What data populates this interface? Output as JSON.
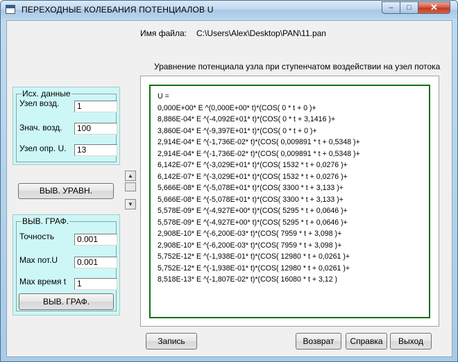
{
  "window": {
    "title": "ПЕРЕХОДНЫЕ КОЛЕБАНИЯ ПОТЕНЦИАЛОВ  U",
    "controls": {
      "minimize": "‒",
      "maximize": "□",
      "close": "✕"
    }
  },
  "file": {
    "label": "Имя файла:",
    "path": "C:\\Users\\Alex\\Desktop\\PAN\\11.pan"
  },
  "equation_caption": "Уравнение  потенциала  узла  при ступенчатом воздействии на узел   потока",
  "input_data": {
    "title": "Исх. данные",
    "fields": [
      {
        "label": "Узел  возд.",
        "value": "1"
      },
      {
        "label": "Знач. возд.",
        "value": "100"
      },
      {
        "label": "Узел опр. U.",
        "value": "13"
      }
    ]
  },
  "show_equation_button": "ВЫВ. УРАВН.",
  "graph": {
    "title": "ВЫВ. ГРАФ.",
    "fields": [
      {
        "label": "Точность",
        "value": "0.001"
      },
      {
        "label": "Max пот.U",
        "value": "0.001"
      },
      {
        "label": "Max время t",
        "value": "1"
      }
    ],
    "button": "ВЫВ. ГРАФ."
  },
  "scroll": {
    "up_arrow": "▲",
    "down_arrow": "▼"
  },
  "equation_lines": [
    "U =",
    "0,000E+00* E ^(0,000E+00* t)*(COS( 0 * t + 0 )+",
    "8,886E-04* E ^(-4,092E+01* t)*(COS( 0 * t + 3,1416 )+",
    "3,860E-04* E ^(-9,397E+01* t)*(COS( 0 * t + 0 )+",
    "2,914E-04* E ^(-1,736E-02* t)*(COS( 0,009891 * t + 0,5348 )+",
    "2,914E-04* E ^(-1,736E-02* t)*(COS( 0,009891 * t + 0,5348 )+",
    "6,142E-07* E ^(-3,029E+01* t)*(COS( 1532 * t + 0,0276 )+",
    "6,142E-07* E ^(-3,029E+01* t)*(COS( 1532 * t + 0,0276 )+",
    "5,666E-08* E ^(-5,078E+01* t)*(COS( 3300 * t + 3,133 )+",
    "5,666E-08* E ^(-5,078E+01* t)*(COS( 3300 * t + 3,133 )+",
    "5,578E-09* E ^(-4,927E+00* t)*(COS( 5295 * t + 0,0646 )+",
    "5,578E-09* E ^(-4,927E+00* t)*(COS( 5295 * t + 0,0646 )+",
    "2,908E-10* E ^(-6,200E-03* t)*(COS( 7959 * t + 3,098 )+",
    "2,908E-10* E ^(-6,200E-03* t)*(COS( 7959 * t + 3,098 )+",
    "5,752E-12* E ^(-1,938E-01* t)*(COS( 12980 * t + 0,0261 )+",
    "5,752E-12* E ^(-1,938E-01* t)*(COS( 12980 * t + 0,0261 )+",
    "8,518E-13* E ^(-1,807E-02* t)*(COS( 16080 * t + 3,12 )"
  ],
  "buttons": {
    "save": "Запись",
    "back": "Возврат",
    "help": "Справка",
    "exit": "Выход"
  },
  "colors": {
    "panel": "#cdf7f7",
    "equation_border": "#107010",
    "client": "#f0f0f0",
    "close_button": "#c4381f"
  }
}
